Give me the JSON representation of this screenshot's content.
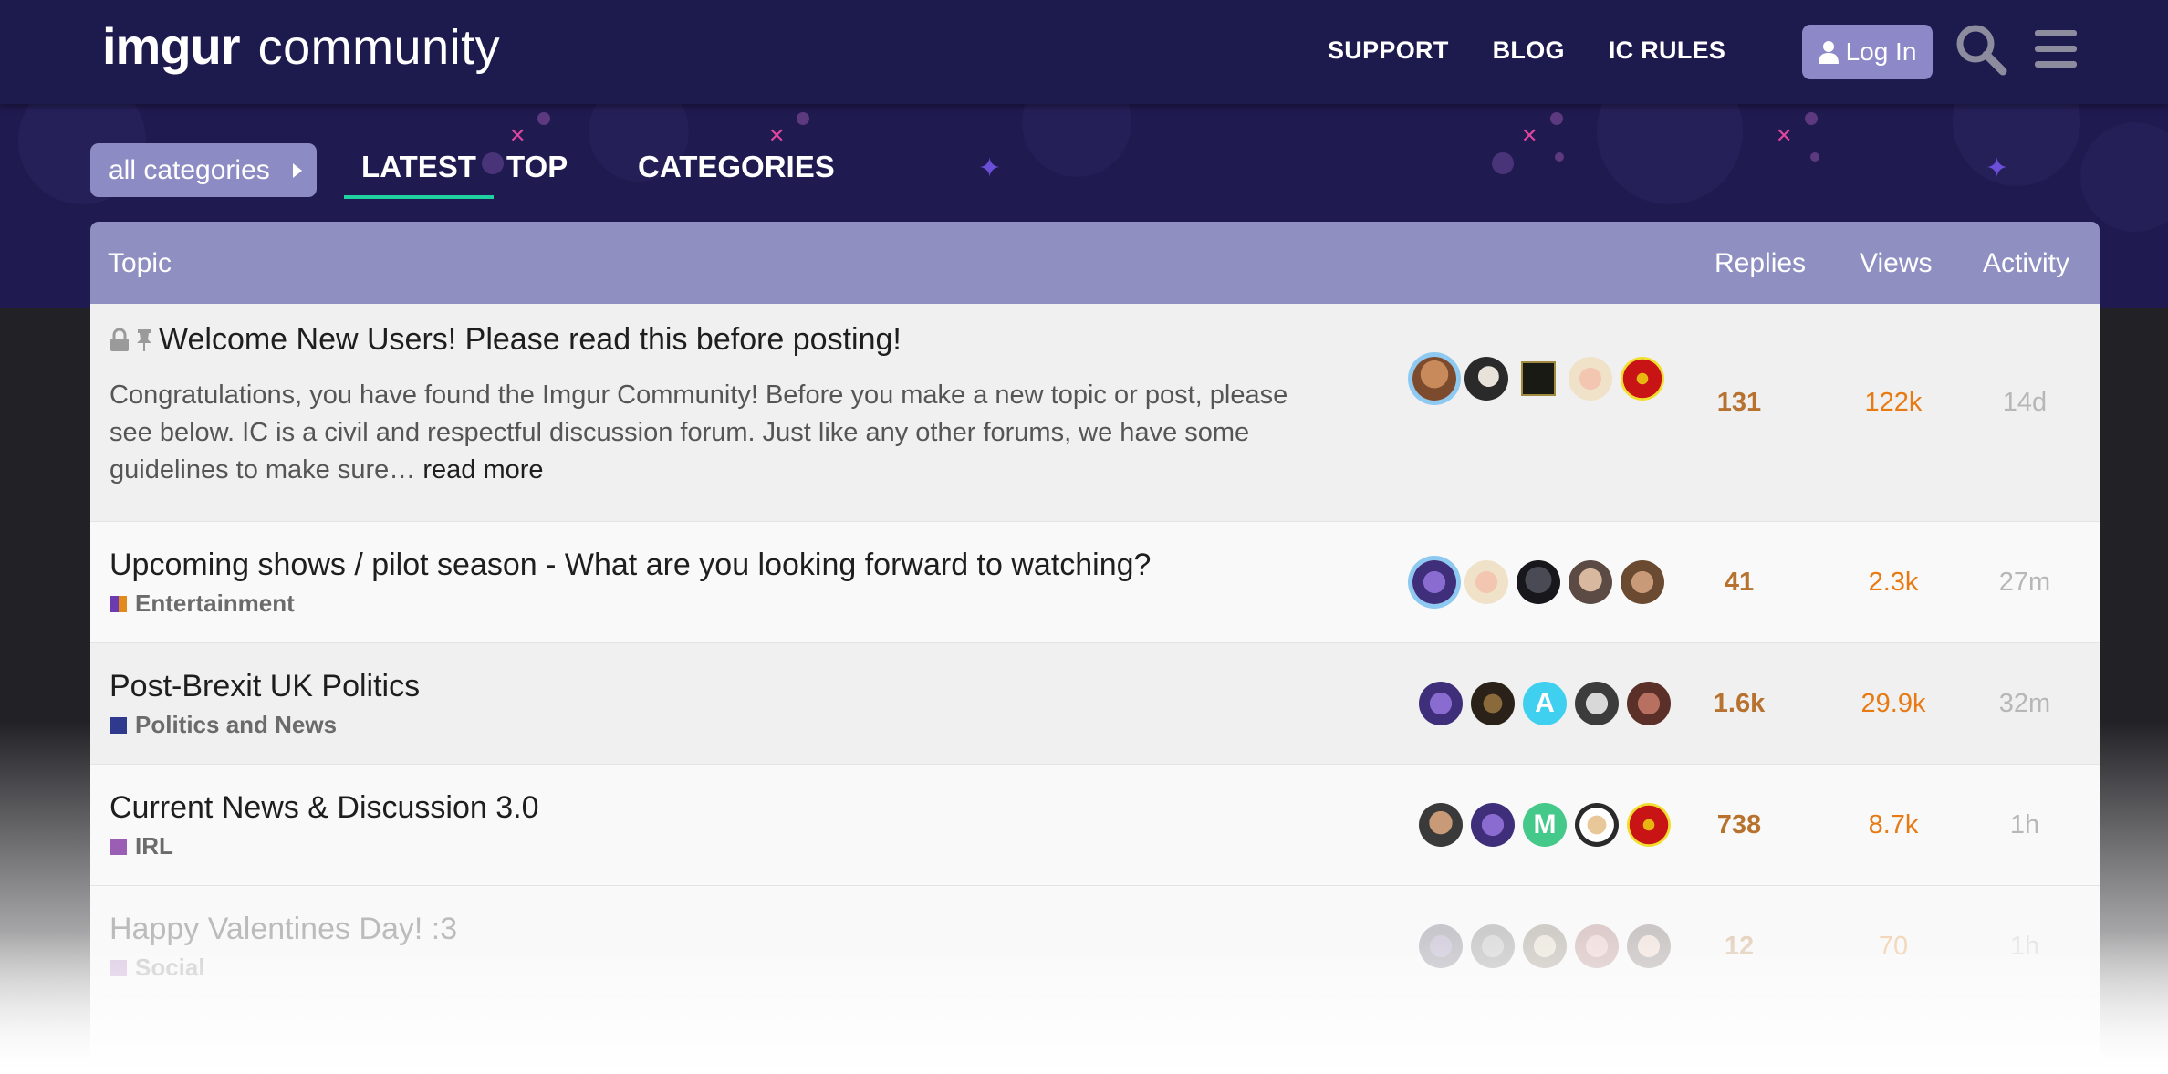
{
  "header": {
    "logo_primary": "imgur",
    "logo_secondary": "community",
    "nav": [
      "SUPPORT",
      "BLOG",
      "IC RULES"
    ],
    "login_label": "Log In",
    "icons": [
      "user-icon",
      "search-icon",
      "hamburger-menu-icon"
    ]
  },
  "filters": {
    "category_dropdown": "all categories",
    "tabs": [
      "LATEST",
      "TOP",
      "CATEGORIES"
    ],
    "active_tab": "LATEST"
  },
  "table": {
    "columns": {
      "topic": "Topic",
      "replies": "Replies",
      "views": "Views",
      "activity": "Activity"
    },
    "rows": [
      {
        "title": "Welcome New Users! Please read this before posting!",
        "status_icons": [
          "lock-icon",
          "pin-icon"
        ],
        "excerpt": "Congratulations, you have found the Imgur Community! Before you make a new topic or post, please see below. IC is a civil and respectful discussion forum. Just like any other forums, we have some guidelines to make sure…",
        "read_more": "read more",
        "replies": "131",
        "views": "122k",
        "activity": "14d"
      },
      {
        "title": "Upcoming shows / pilot season - What are you looking forward to watching?",
        "category": "Entertainment",
        "replies": "41",
        "views": "2.3k",
        "activity": "27m"
      },
      {
        "title": "Post-Brexit UK Politics",
        "category": "Politics and News",
        "avatar_letter": "A",
        "replies": "1.6k",
        "views": "29.9k",
        "activity": "32m"
      },
      {
        "title": "Current News & Discussion 3.0",
        "category": "IRL",
        "avatar_letter": "M",
        "replies": "738",
        "views": "8.7k",
        "activity": "1h"
      },
      {
        "title": "Happy Valentines Day! :3",
        "category": "Social",
        "replies": "12",
        "views": "70",
        "activity": "1h"
      }
    ]
  },
  "colors": {
    "header_bg": "#1d1a4d",
    "table_header_bg": "#8f8fc2",
    "active_tab_underline": "#1fd1a0",
    "replies_color": "#b7722f",
    "views_color": "#e77a12",
    "category_entertainment": "#e38a1f",
    "category_politics": "#2f3a8f",
    "category_irl": "#9a5fb4",
    "category_social": "#c9a8de"
  }
}
